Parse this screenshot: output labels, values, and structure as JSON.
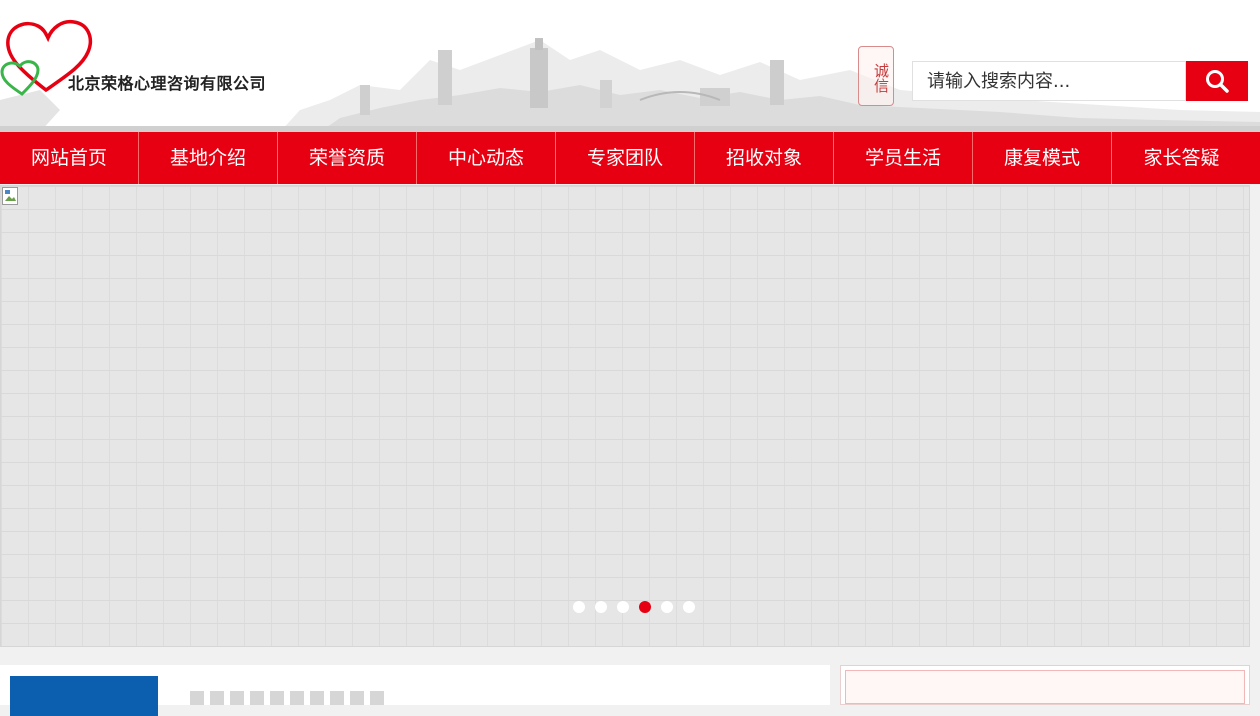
{
  "header": {
    "company_name": "北京荣格心理咨询有限公司",
    "seal_text": "诚信",
    "logo_icon": "heart-logo-icon",
    "colors": {
      "brand_red": "#e60012",
      "logo_green": "#39b54a"
    }
  },
  "search": {
    "placeholder": "请输入搜索内容...",
    "button_icon": "search-icon"
  },
  "nav": {
    "items": [
      {
        "label": "网站首页"
      },
      {
        "label": "基地介绍"
      },
      {
        "label": "荣誉资质"
      },
      {
        "label": "中心动态"
      },
      {
        "label": "专家团队"
      },
      {
        "label": "招收对象"
      },
      {
        "label": "学员生活"
      },
      {
        "label": "康复模式"
      },
      {
        "label": "家长答疑"
      }
    ]
  },
  "banner": {
    "slide_count": 6,
    "active_slide": 4,
    "broken_image_icon": "broken-image-icon"
  }
}
